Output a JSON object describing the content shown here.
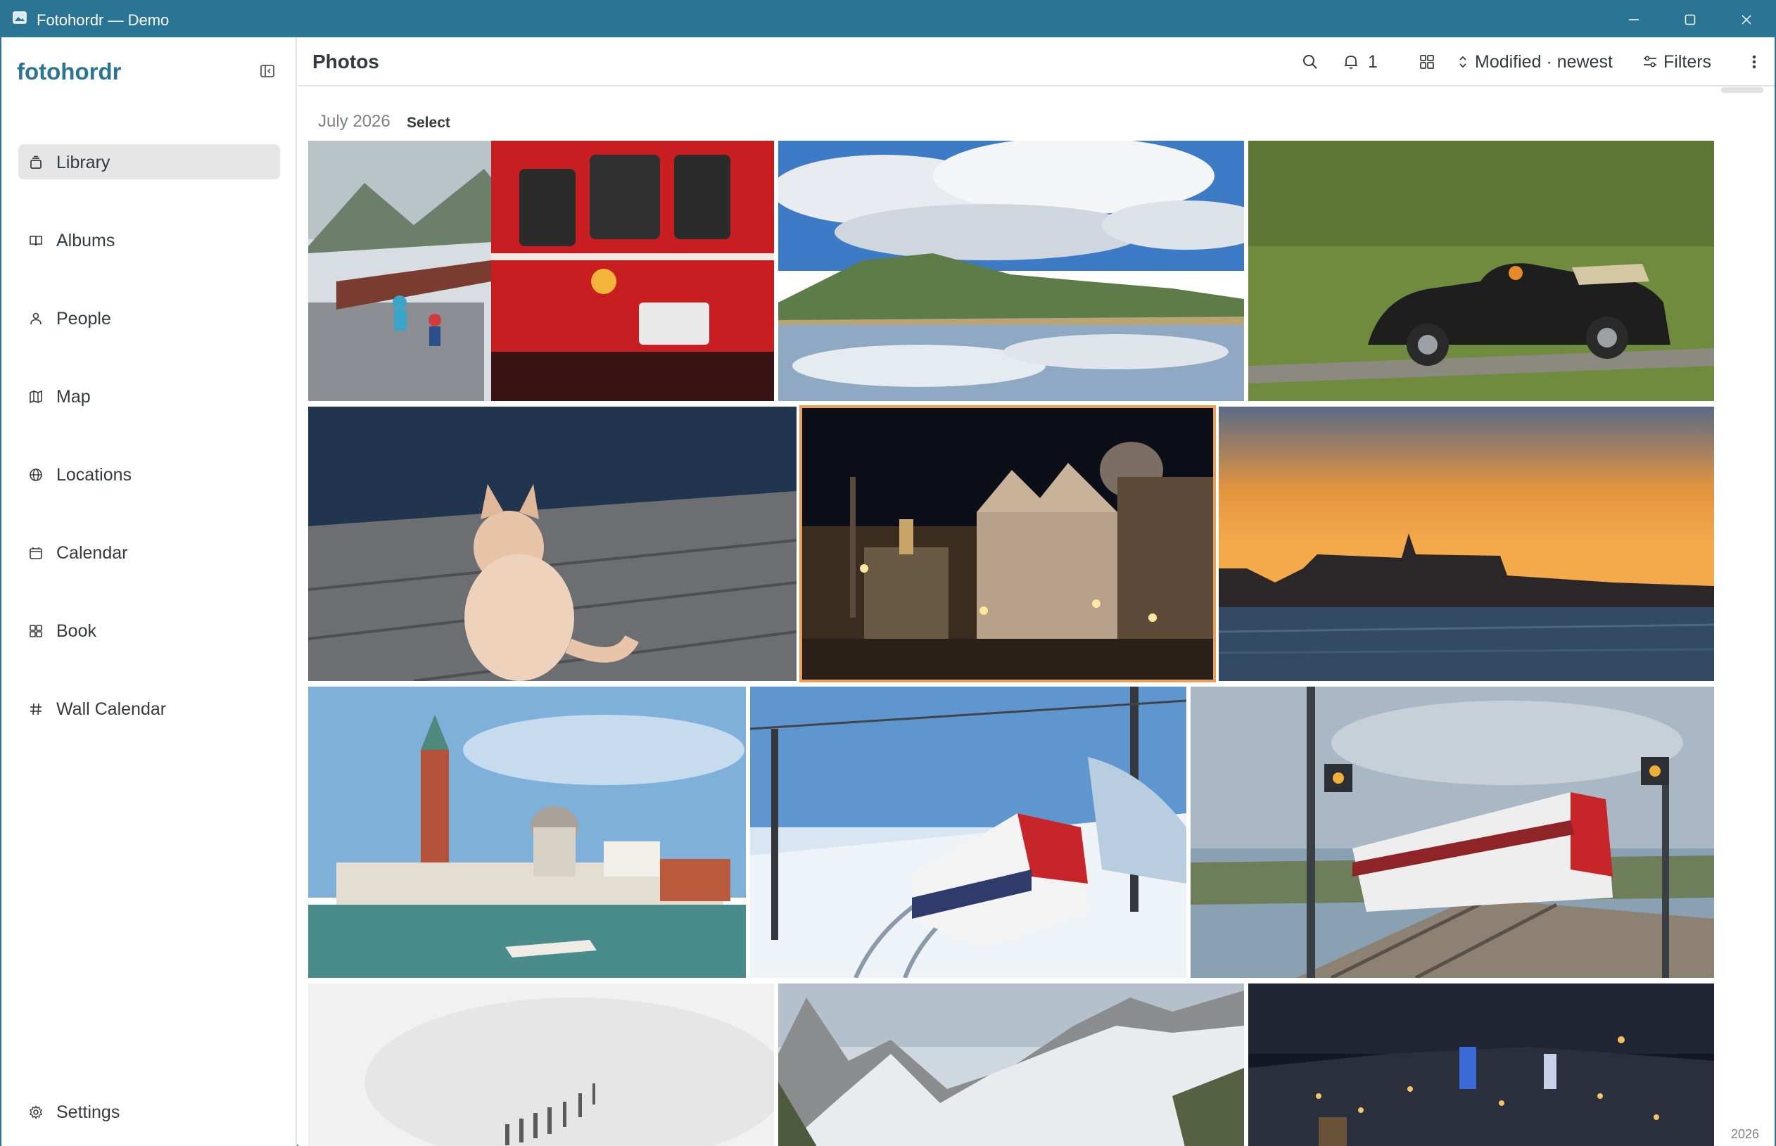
{
  "window": {
    "title": "Fotohordr — Demo",
    "accent": "#2a7596"
  },
  "sidebar": {
    "brand": "fotohordr",
    "items": [
      {
        "label": "Library",
        "icon": "library-icon",
        "active": true
      },
      {
        "label": "Albums",
        "icon": "book-open-icon"
      },
      {
        "label": "People",
        "icon": "person-icon"
      },
      {
        "label": "Map",
        "icon": "map-icon"
      },
      {
        "label": "Locations",
        "icon": "globe-icon"
      },
      {
        "label": "Calendar",
        "icon": "calendar-icon"
      },
      {
        "label": "Book",
        "icon": "layout-grid-icon"
      },
      {
        "label": "Wall Calendar",
        "icon": "hash-icon"
      }
    ],
    "settings": {
      "label": "Settings",
      "icon": "gear-icon"
    }
  },
  "header": {
    "title": "Photos",
    "notification_count": "1",
    "sort_label": "Modified · newest",
    "filters_label": "Filters"
  },
  "content": {
    "group_date": "July 2026",
    "select_label": "Select",
    "year_marker": "2026",
    "photos": [
      {
        "subject": "red-train-platform-children"
      },
      {
        "subject": "mountain-lake-reflection-clouds"
      },
      {
        "subject": "black-vintage-convertible-beetle"
      },
      {
        "subject": "fluffy-cat-on-pavement"
      },
      {
        "subject": "venice-st-marks-night",
        "selected": true
      },
      {
        "subject": "venice-skyline-sunset"
      },
      {
        "subject": "venice-campanile-san-giorgio"
      },
      {
        "subject": "snowy-red-white-train"
      },
      {
        "subject": "double-decker-train-signals"
      },
      {
        "subject": "snowy-fence-white"
      },
      {
        "subject": "snowy-mountain-peaks"
      },
      {
        "subject": "city-night-lights"
      }
    ]
  }
}
